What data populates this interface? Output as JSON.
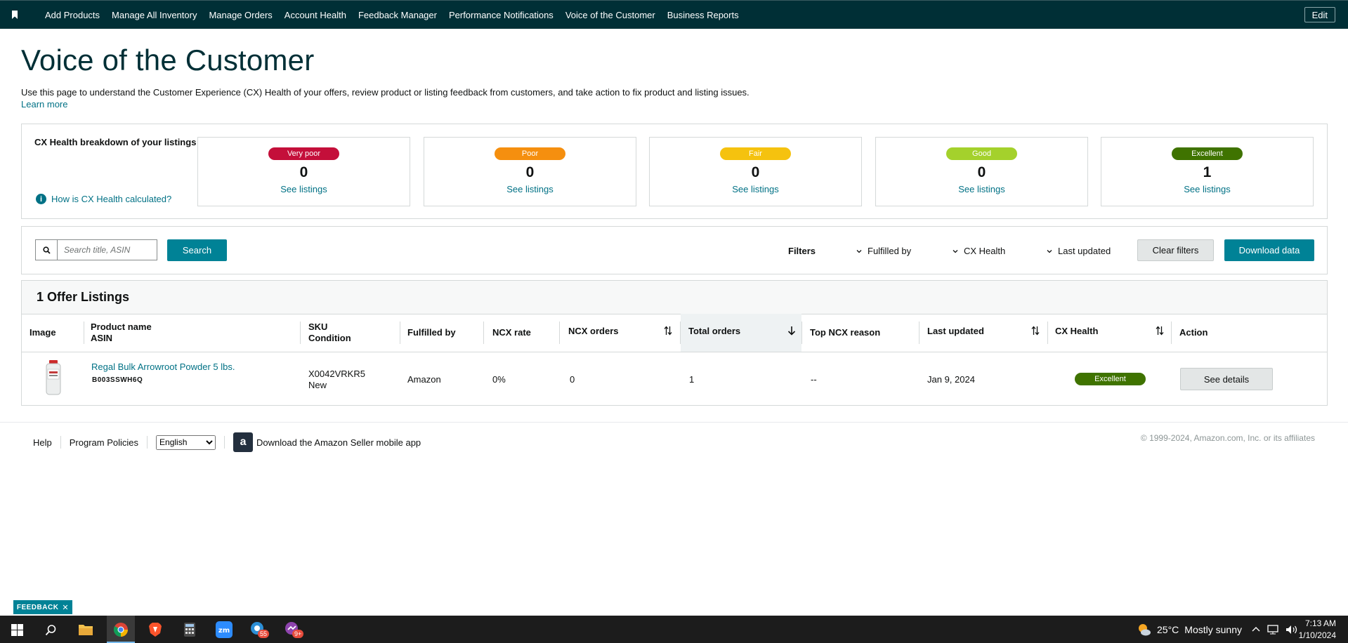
{
  "topnav": {
    "items": [
      "Add Products",
      "Manage All Inventory",
      "Manage Orders",
      "Account Health",
      "Feedback Manager",
      "Performance Notifications",
      "Voice of the Customer",
      "Business Reports"
    ],
    "edit_label": "Edit"
  },
  "page": {
    "title": "Voice of the Customer",
    "description": "Use this page to understand the Customer Experience (CX) Health of your offers, review product or listing feedback from customers, and take action to fix product and listing issues.",
    "learn_more": "Learn more"
  },
  "cx_health": {
    "title": "CX Health breakdown of your listings",
    "how_link": "How is CX Health calculated?",
    "cards": [
      {
        "label": "Very poor",
        "count": "0",
        "link": "See listings",
        "color": "#c40f3a"
      },
      {
        "label": "Poor",
        "count": "0",
        "link": "See listings",
        "color": "#f58f0f"
      },
      {
        "label": "Fair",
        "count": "0",
        "link": "See listings",
        "color": "#f5c20f"
      },
      {
        "label": "Good",
        "count": "0",
        "link": "See listings",
        "color": "#a4d12c"
      },
      {
        "label": "Excellent",
        "count": "1",
        "link": "See listings",
        "color": "#3f7300"
      }
    ]
  },
  "filters": {
    "search_placeholder": "Search title, ASIN",
    "search_button": "Search",
    "filters_label": "Filters",
    "fulfilled_by": "Fulfilled by",
    "cx_health": "CX Health",
    "last_updated": "Last updated",
    "clear_filters": "Clear filters",
    "download_data": "Download data"
  },
  "listings": {
    "heading": "1 Offer Listings",
    "columns": {
      "image": "Image",
      "product_name": "Product name",
      "asin": "ASIN",
      "sku": "SKU",
      "condition": "Condition",
      "fulfilled_by": "Fulfilled by",
      "ncx_rate": "NCX rate",
      "ncx_orders": "NCX orders",
      "total_orders": "Total orders",
      "top_ncx_reason": "Top NCX reason",
      "last_updated": "Last updated",
      "cx_health": "CX Health",
      "action": "Action"
    },
    "rows": [
      {
        "product_name": "Regal Bulk Arrowroot Powder 5 lbs.",
        "asin": "B003SSWH6Q",
        "sku": "X0042VRKR5",
        "condition": "New",
        "fulfilled_by": "Amazon",
        "ncx_rate": "0%",
        "ncx_orders": "0",
        "total_orders": "1",
        "top_ncx_reason": "--",
        "last_updated": "Jan 9, 2024",
        "cx_health": "Excellent",
        "action": "See details"
      }
    ]
  },
  "footer": {
    "help": "Help",
    "program_policies": "Program Policies",
    "language": "English",
    "app_link": "Download the Amazon Seller mobile app",
    "copyright": "© 1999-2024, Amazon.com, Inc. or its affiliates"
  },
  "feedback_tab": "FEEDBACK",
  "taskbar": {
    "weather_temp": "25°C",
    "weather_text": "Mostly sunny",
    "time": "7:13 AM",
    "date": "1/10/2024",
    "badge_mail": "55",
    "badge_chat": "9+"
  }
}
